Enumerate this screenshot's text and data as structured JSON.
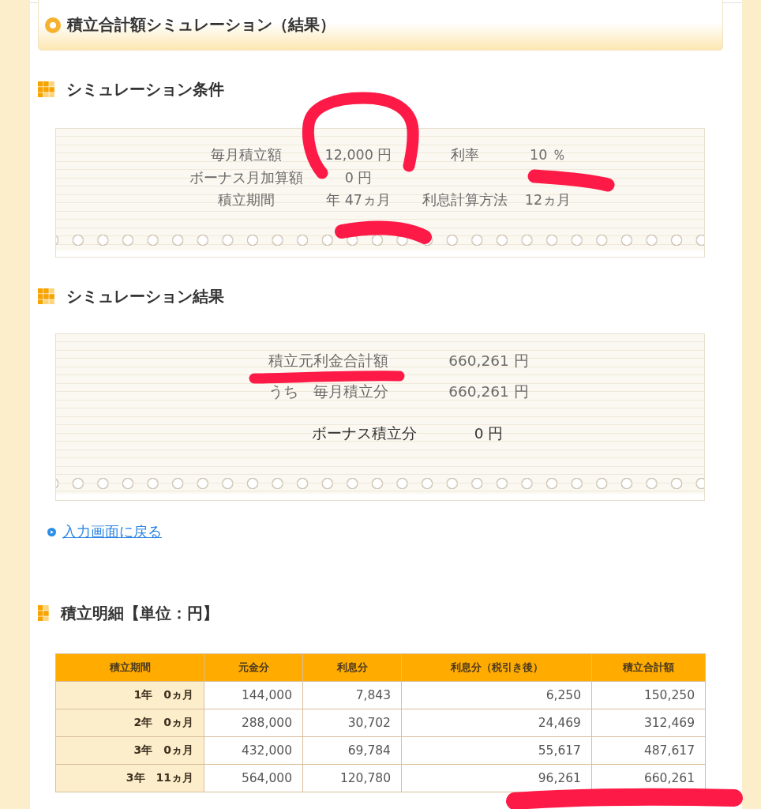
{
  "title": "積立合計額シミュレーション（結果）",
  "conditions": {
    "heading": "シミュレーション条件",
    "rows": [
      {
        "cells": [
          "毎月積立額",
          "12,000 円",
          "利率",
          "10 ％"
        ]
      },
      {
        "cells": [
          "ボーナス月加算額",
          "0 円"
        ]
      },
      {
        "cells": [
          "積立期間",
          "年 47ヵ月",
          "利息計算方法",
          "12ヵ月"
        ]
      }
    ]
  },
  "results": {
    "heading": "シミュレーション結果",
    "rows": [
      {
        "label": "積立元利金合計額",
        "value": "660,261 円"
      },
      {
        "label": "うち　毎月積立分",
        "value": "660,261 円"
      }
    ],
    "bonus": {
      "label": "ボーナス積立分",
      "value": "0 円"
    }
  },
  "back_link": {
    "label": "入力画面に戻る"
  },
  "details": {
    "heading": "積立明細【単位：円】",
    "table": {
      "columns": [
        "積立期間",
        "元金分",
        "利息分",
        "利息分（税引き後）",
        "積立合計額"
      ],
      "rows": [
        [
          "1年　0ヵ月",
          "144,000",
          "7,843",
          "6,250",
          "150,250"
        ],
        [
          "2年　0ヵ月",
          "288,000",
          "30,702",
          "24,469",
          "312,469"
        ],
        [
          "3年　0ヵ月",
          "432,000",
          "69,784",
          "55,617",
          "487,617"
        ],
        [
          "3年　11ヵ月",
          "564,000",
          "120,780",
          "96,261",
          "660,261"
        ]
      ]
    }
  }
}
